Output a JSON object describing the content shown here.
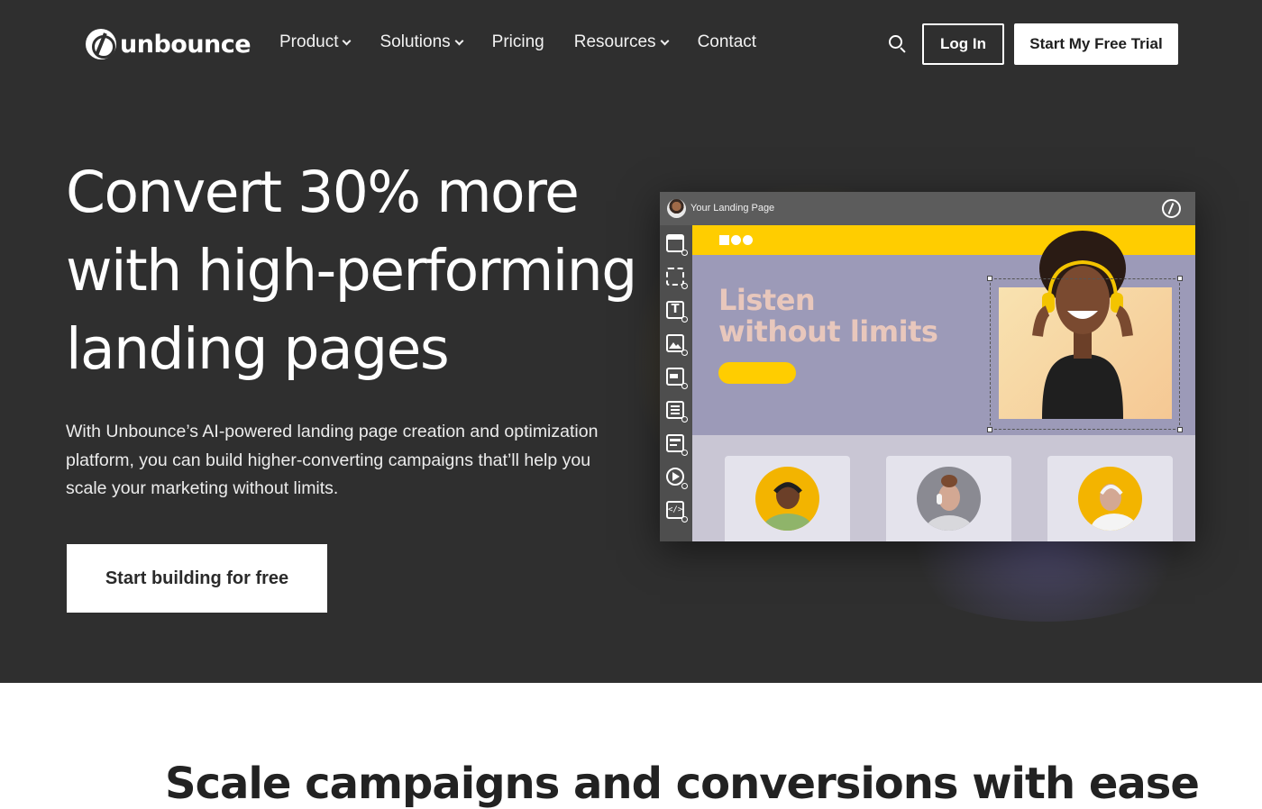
{
  "brand": {
    "name": "unbounce"
  },
  "nav": {
    "items": [
      {
        "label": "Product",
        "has_dropdown": true
      },
      {
        "label": "Solutions",
        "has_dropdown": true
      },
      {
        "label": "Pricing",
        "has_dropdown": false
      },
      {
        "label": "Resources",
        "has_dropdown": true
      },
      {
        "label": "Contact",
        "has_dropdown": false
      }
    ],
    "search_icon": "search-icon",
    "login_label": "Log In",
    "trial_label": "Start My Free Trial"
  },
  "hero": {
    "headline_lines": [
      "Convert 30% more",
      "with high-performing",
      "landing pages"
    ],
    "subtext": "With Unbounce’s AI-powered landing page creation and optimization platform, you can build higher-converting campaigns that’ll help you scale your marketing without limits.",
    "cta_label": "Start building for free"
  },
  "mockup": {
    "window_title": "Your Landing Page",
    "heading_lines": [
      "Listen",
      "without limits"
    ],
    "tools": [
      "section-icon",
      "box-icon",
      "text-icon",
      "image-icon",
      "button-icon",
      "form-icon",
      "list-icon",
      "video-icon",
      "code-icon"
    ]
  },
  "colors": {
    "hero_bg": "#2f2f2f",
    "accent_yellow": "#ffcd00",
    "mock_panel": "#9c9ab8",
    "mock_heading": "#e8c7bc"
  },
  "next_section": {
    "heading": "Scale campaigns and conversions with ease"
  }
}
